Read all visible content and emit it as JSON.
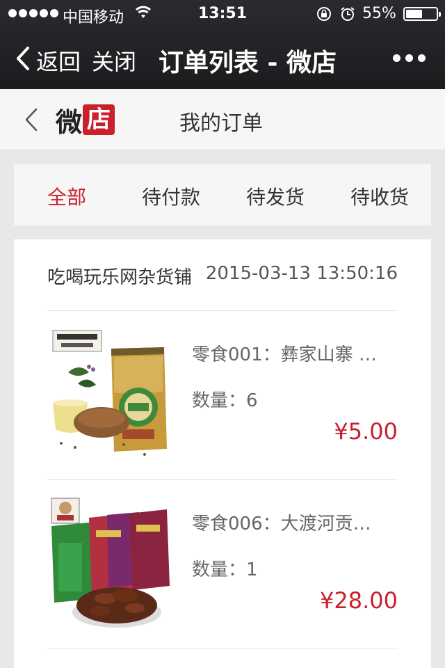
{
  "status": {
    "carrier": "中国移动",
    "time": "13:51",
    "battery_pct": "55%",
    "battery_level": 0.55
  },
  "nav": {
    "back_label": "返回",
    "close_label": "关闭",
    "title": "订单列表 - 微店"
  },
  "shop_header": {
    "logo_wei": "微",
    "logo_dian": "店",
    "page_title": "我的订单"
  },
  "tabs": [
    {
      "label": "全部",
      "active": true
    },
    {
      "label": "待付款",
      "active": false
    },
    {
      "label": "待发货",
      "active": false
    },
    {
      "label": "待收货",
      "active": false
    }
  ],
  "order": {
    "shop_name": "吃喝玩乐网杂货铺",
    "timestamp": "2015-03-13 13:50:16",
    "items": [
      {
        "name": "零食001：彝家山寨 …",
        "quantity": "数量：6",
        "price": "¥5.00",
        "image": "buckwheat-tea-package"
      },
      {
        "name": "零食006：大渡河贡…",
        "quantity": "数量：1",
        "price": "¥28.00",
        "image": "beef-jerky-packages"
      }
    ]
  },
  "colors": {
    "accent": "#c9202c",
    "navbar": "#1c1c1f",
    "background": "#e8e8ea"
  }
}
